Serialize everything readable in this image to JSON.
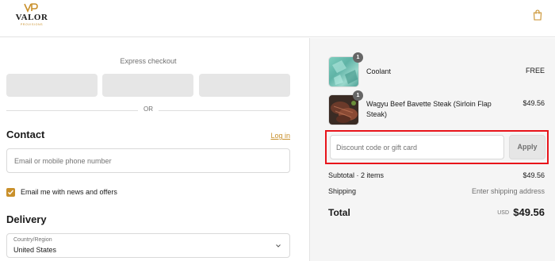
{
  "header": {
    "brand": "VALOR",
    "brand_sub": "PROVISIONS",
    "brand_mark": "VP",
    "bag_icon": "shopping-bag-icon",
    "accent_color": "#c9902b"
  },
  "checkout": {
    "express_title": "Express checkout",
    "or_label": "OR",
    "contact": {
      "title": "Contact",
      "login_link": "Log in",
      "email_placeholder": "Email or mobile phone number",
      "newsletter_label": "Email me with news and offers",
      "newsletter_checked": true
    },
    "delivery": {
      "title": "Delivery",
      "country_label": "Country/Region",
      "country_value": "United States"
    }
  },
  "summary": {
    "items": [
      {
        "name": "Coolant",
        "qty": "1",
        "price": "FREE"
      },
      {
        "name": "Wagyu Beef Bavette Steak (Sirloin Flap Steak)",
        "qty": "1",
        "price": "$49.56"
      }
    ],
    "discount": {
      "placeholder": "Discount code or gift card",
      "apply_label": "Apply",
      "highlight_color": "#e8141b"
    },
    "subtotal_label": "Subtotal · 2 items",
    "subtotal_value": "$49.56",
    "shipping_label": "Shipping",
    "shipping_value": "Enter shipping address",
    "total_label": "Total",
    "total_currency": "USD",
    "total_value": "$49.56"
  }
}
